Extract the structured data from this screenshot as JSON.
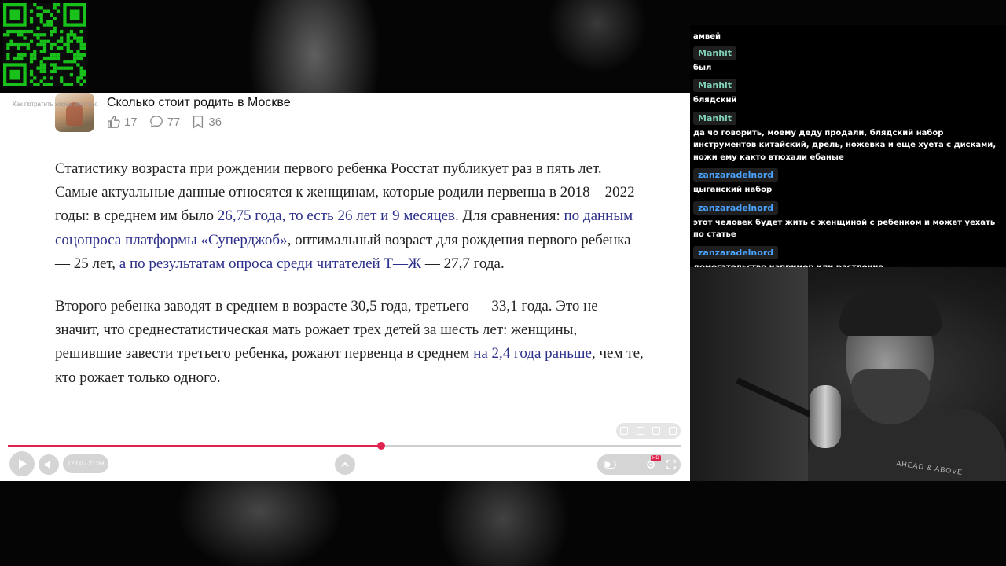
{
  "article": {
    "overlay_text": "Как потратить жизнь впустую",
    "title": "Сколько стоит родить в Москве",
    "likes": "17",
    "comments": "77",
    "bookmarks": "36",
    "p1": [
      {
        "t": "Статистику возраста при рождении первого ребенка Росстат публикует раз в пять лет. Самые актуальные данные относятся к женщинам, которые родили первенца в 2018—2022 годы: в среднем им было ",
        "link": false
      },
      {
        "t": "26,75 года, то есть 26 лет и 9 месяцев",
        "link": true
      },
      {
        "t": ". Для сравнения: ",
        "link": false
      },
      {
        "t": "по данным соцопроса платформы «Суперджоб»",
        "link": true
      },
      {
        "t": ", оптимальный возраст для рождения первого ребенка — 25 лет, ",
        "link": false
      },
      {
        "t": "а по результатам опроса среди читателей Т—Ж",
        "link": true
      },
      {
        "t": " — 27,7 года.",
        "link": false
      }
    ],
    "p2": [
      {
        "t": "Второго ребенка заводят в среднем в возрасте 30,5 года, третьего — 33,1 года. Это не значит, что среднестатистическая мать рожает трех детей за шесть лет: женщины, решившие завести третьего ребенка, рожают первенца в среднем ",
        "link": false
      },
      {
        "t": "на 2,4 года раньше",
        "link": true
      },
      {
        "t": ", чем те, кто рожает только одного.",
        "link": false
      }
    ]
  },
  "player": {
    "time": "12:00 / 21:39",
    "progress_fraction": 0.555,
    "hd_badge": "HD",
    "accent": "#e0234f"
  },
  "chat": {
    "messages": [
      {
        "user": "",
        "text": "амвей",
        "color": "#7fd1b9"
      },
      {
        "user": "Manhit",
        "text": "был",
        "color": "#7fd1b9"
      },
      {
        "user": "Manhit",
        "text": "блядский",
        "color": "#7fd1b9"
      },
      {
        "user": "Manhit",
        "text": "да чо говорить, моему деду продали, блядский набор инструментов китайский, дрель, ножевка и еще хуета с дисками, ножи ему както втюхали ебаные",
        "color": "#7fd1b9"
      },
      {
        "user": "zanzaradelnord",
        "text": "цыганский набор",
        "color": "#4aa3ff"
      },
      {
        "user": "zanzaradelnord",
        "text": "этот человек будет жить с женщиной с ребенком и может уехать по статье",
        "color": "#4aa3ff"
      },
      {
        "user": "zanzaradelnord",
        "text": "домогательство например или растление",
        "color": "#4aa3ff"
      }
    ]
  },
  "webcam": {
    "shirt_text": "AHEAD & ABOVE"
  },
  "icons": [
    "qr-code-icon",
    "like-icon",
    "comment-icon",
    "bookmark-icon",
    "play-icon",
    "volume-icon",
    "chevron-up-icon",
    "settings-icon",
    "fullscreen-icon"
  ]
}
